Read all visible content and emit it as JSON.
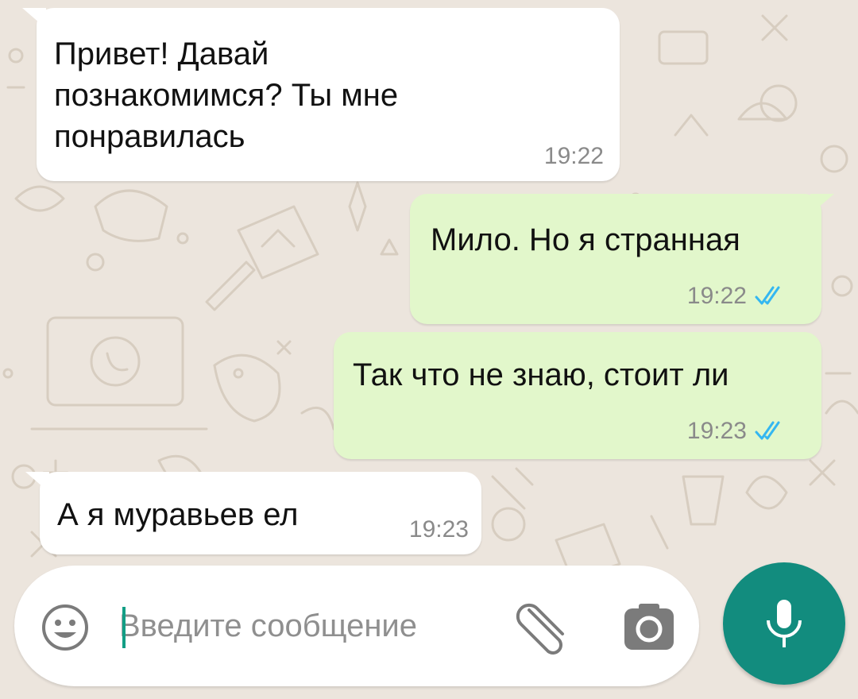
{
  "colors": {
    "wallpaper": "#ece5dd",
    "incoming_bubble": "#ffffff",
    "outgoing_bubble": "#e2f7cb",
    "read_ticks": "#34b7f1",
    "accent": "#128c7e"
  },
  "messages": [
    {
      "direction": "incoming",
      "text": "Привет! Давай\nпознакомимся? Ты мне\nпонравилась",
      "time": "19:22"
    },
    {
      "direction": "outgoing",
      "text": "Мило. Но я странная",
      "time": "19:22",
      "status": "read"
    },
    {
      "direction": "outgoing",
      "text": "Так что не знаю, стоит ли",
      "time": "19:23",
      "status": "read"
    },
    {
      "direction": "incoming",
      "text": "А я муравьев ел",
      "time": "19:23"
    }
  ],
  "composer": {
    "placeholder": "Введите сообщение",
    "value": "",
    "icons": {
      "emoji": "emoji-icon",
      "attach": "paperclip-icon",
      "camera": "camera-icon",
      "mic": "microphone-icon"
    }
  }
}
